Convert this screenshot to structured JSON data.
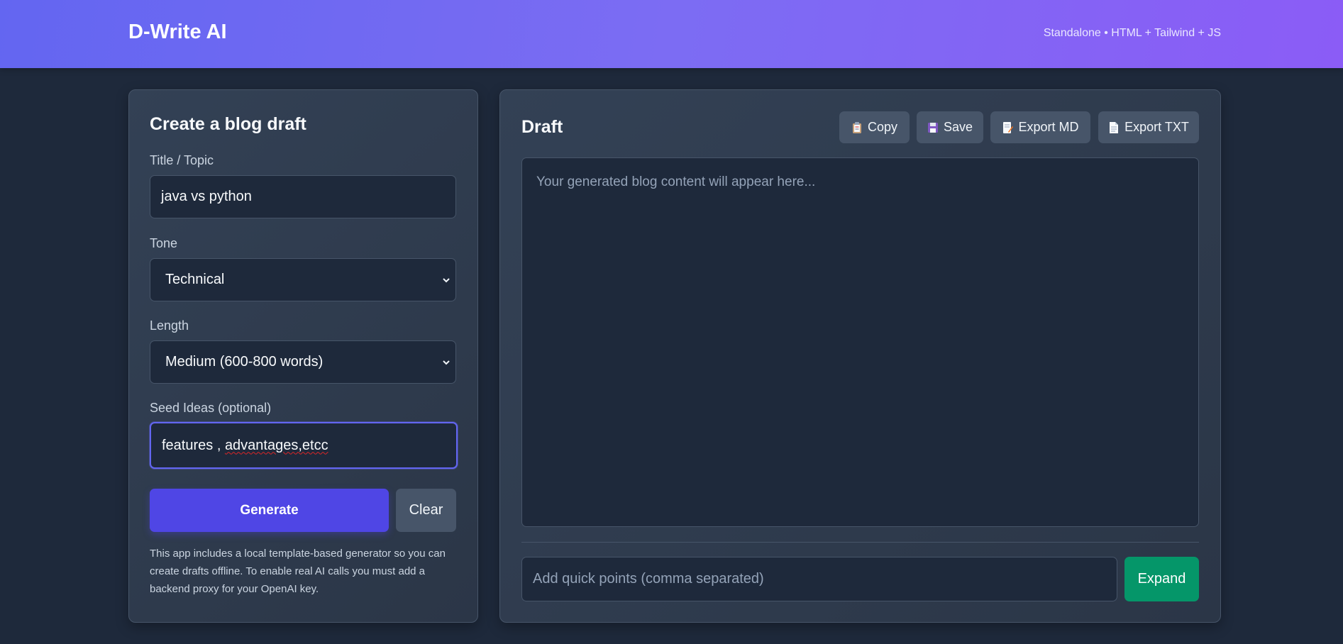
{
  "header": {
    "brand": "D-Write AI",
    "tagline": "Standalone • HTML + Tailwind + JS"
  },
  "left_panel": {
    "title": "Create a blog draft",
    "title_label": "Title / Topic",
    "title_value": "java vs python",
    "tone_label": "Tone",
    "tone_value": "Technical",
    "length_label": "Length",
    "length_value": "Medium (600-800 words)",
    "seed_label": "Seed Ideas (optional)",
    "seed_value_a": "features , ",
    "seed_value_b": "advantages,etcc",
    "generate_label": "Generate",
    "clear_label": "Clear",
    "note": "This app includes a local template-based generator so you can create drafts offline. To enable real AI calls you must add a backend proxy for your OpenAI key."
  },
  "right_panel": {
    "title": "Draft",
    "toolbar": {
      "copy_label": "Copy",
      "save_label": "Save",
      "export_md_label": "Export MD",
      "export_txt_label": "Export TXT"
    },
    "draft_placeholder": "Your generated blog content will appear here...",
    "quick_points_placeholder": "Add quick points (comma separated)",
    "expand_label": "Expand"
  },
  "colors": {
    "header_gradient_start": "#6366f1",
    "header_gradient_end": "#8b5cf6",
    "primary": "#4f46e5",
    "expand": "#059669",
    "background": "#1e293b",
    "card": "#334155"
  },
  "icons": [
    "clipboard-icon",
    "floppy-disk-icon",
    "memo-icon",
    "page-icon",
    "chevron-down-icon"
  ]
}
